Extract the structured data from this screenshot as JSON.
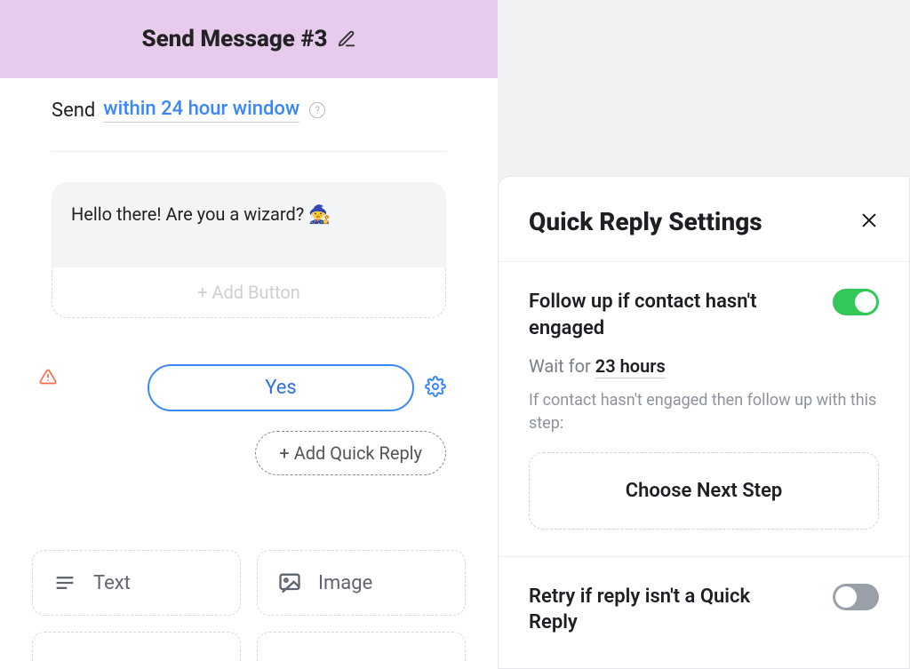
{
  "header": {
    "title": "Send Message #3"
  },
  "sendline": {
    "prefix": "Send",
    "link": "within 24 hour window",
    "help": "?"
  },
  "message": {
    "text": "Hello there! Are you a wizard? 🧙",
    "add_button": "+ Add Button"
  },
  "quick_reply": {
    "items": [
      "Yes"
    ],
    "add": "+ Add Quick Reply"
  },
  "cards": {
    "text": "Text",
    "image": "Image"
  },
  "panel": {
    "title": "Quick Reply Settings",
    "followup": {
      "label": "Follow up if contact hasn't engaged",
      "enabled": true,
      "wait_prefix": "Wait for",
      "wait_value": "23 hours",
      "helper": "If contact hasn't engaged then follow up with this step:",
      "choose": "Choose Next Step"
    },
    "retry": {
      "label": "Retry if reply isn't a Quick Reply",
      "enabled": false
    }
  }
}
